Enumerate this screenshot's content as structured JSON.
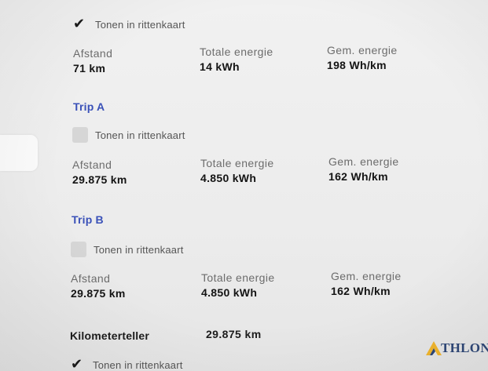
{
  "current_trip": {
    "show_in_map_label": "Tonen in rittenkaart",
    "show_in_map_checked": true,
    "distance_label": "Afstand",
    "distance_value": "71 km",
    "energy_label": "Totale energie",
    "energy_value": "14 kWh",
    "avg_label": "Gem. energie",
    "avg_value": "198 Wh/km"
  },
  "trip_a": {
    "title": "Trip A",
    "show_in_map_label": "Tonen in rittenkaart",
    "show_in_map_checked": false,
    "distance_label": "Afstand",
    "distance_value": "29.875 km",
    "energy_label": "Totale energie",
    "energy_value": "4.850 kWh",
    "avg_label": "Gem. energie",
    "avg_value": "162 Wh/km"
  },
  "trip_b": {
    "title": "Trip B",
    "show_in_map_label": "Tonen in rittenkaart",
    "show_in_map_checked": false,
    "distance_label": "Afstand",
    "distance_value": "29.875 km",
    "energy_label": "Totale energie",
    "energy_value": "4.850 kWh",
    "avg_label": "Gem. energie",
    "avg_value": "162 Wh/km"
  },
  "odometer": {
    "label": "Kilometerteller",
    "value": "29.875 km",
    "show_in_map_label": "Tonen in rittenkaart",
    "show_in_map_checked": true
  },
  "watermark": {
    "text": "THLON"
  },
  "colors": {
    "accent": "#3a51b8",
    "background": "#ededed",
    "checkbox_unchecked": "#d6d6d6"
  }
}
